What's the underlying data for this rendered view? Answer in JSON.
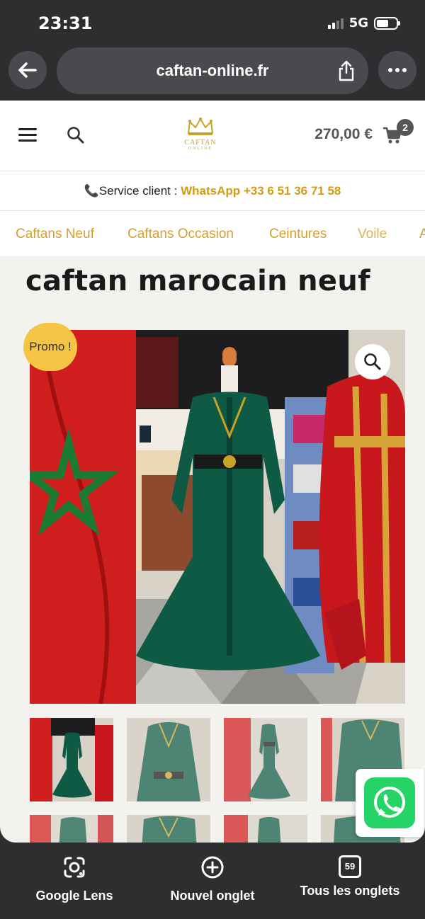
{
  "status": {
    "time": "23:31",
    "network": "5G"
  },
  "browser": {
    "url": "caftan-online.fr"
  },
  "header": {
    "logo_text": "CAFTAN",
    "logo_sub": "ONLINE",
    "cart_total": "270,00 €",
    "cart_count": "2"
  },
  "service": {
    "label": "Service client : ",
    "whatsapp": "WhatsApp +33 6 51 36 71 58"
  },
  "menu": {
    "items": [
      "Caftans Neuf",
      "Caftans Occasion",
      "Ceintures",
      "Voile",
      "A"
    ]
  },
  "product": {
    "title": "caftan marocain neuf",
    "badge": "Promo !"
  },
  "toolbar": {
    "lens": "Google Lens",
    "new_tab": "Nouvel onglet",
    "all_tabs": "Tous les onglets",
    "tab_count": "59"
  },
  "colors": {
    "accent": "#d4a030",
    "whatsapp_green": "#25d366",
    "promo": "#f5c444",
    "dress_green": "#0f5a45",
    "caftan_red": "#d01e1e"
  }
}
